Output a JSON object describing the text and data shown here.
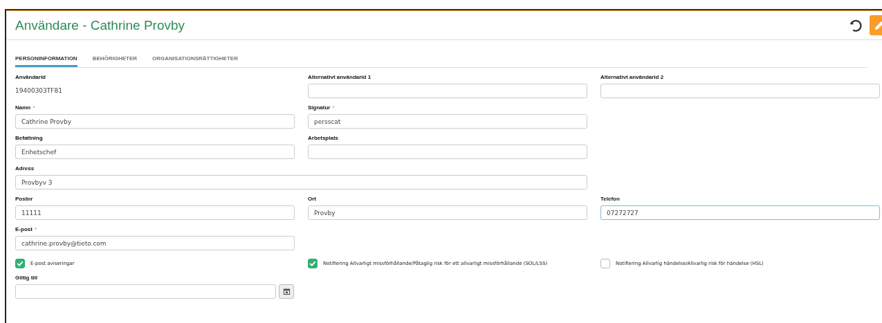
{
  "header": {
    "title": "Användare - Cathrine Provby"
  },
  "tabs": [
    {
      "label": "PERSONINFORMATION",
      "selected": true
    },
    {
      "label": "BEHÖRIGHETER",
      "selected": false
    },
    {
      "label": "ORGANISATIONSRÄTTIGHETER",
      "selected": false
    }
  ],
  "rows": [
    {
      "fields": [
        {
          "kind": "static",
          "label": "Användarid",
          "value": "19400303TF81"
        },
        {
          "kind": "text",
          "label": "Alternativt användarid 1"
        },
        {
          "kind": "text",
          "label": "Alternativt användarid 2"
        }
      ]
    },
    {
      "fields": [
        {
          "kind": "text",
          "label": "Namn",
          "value": "Cathrine Provby",
          "required_mark": "*"
        },
        {
          "kind": "text",
          "label": "Signatur",
          "value": "persscat",
          "required_mark": "*"
        }
      ]
    },
    {
      "fields": [
        {
          "kind": "text",
          "label": "Befattning",
          "value": "Enhetschef"
        },
        {
          "kind": "text",
          "label": "Arbetsplats"
        }
      ]
    },
    {
      "fields": [
        {
          "kind": "text",
          "label": "Adress",
          "value": "Provbyv 3",
          "wide": true
        }
      ]
    },
    {
      "fields": [
        {
          "kind": "text",
          "label": "Postnr",
          "value": "11111"
        },
        {
          "kind": "text",
          "label": "Ort",
          "value": "Provby"
        },
        {
          "kind": "text",
          "label": "Telefon",
          "value": "07272727",
          "focused": true
        }
      ]
    },
    {
      "fields": [
        {
          "kind": "text",
          "label": "E-post",
          "value": "cathrine.provby@tieto.com",
          "required_mark": "*"
        }
      ]
    }
  ],
  "checkboxes": [
    {
      "label": "E-post aviseringar",
      "checked": true
    },
    {
      "label": "Notifiering Allvarligt missförhållande/Påtaglig risk för ett allvarligt missförhållande (SOL/LSS)",
      "checked": true
    },
    {
      "label": "Notifiering Allvarlig händelse/Allvarlig risk för händelse (HSL)",
      "checked": false
    }
  ],
  "date_field": {
    "label": "Giltig till"
  }
}
